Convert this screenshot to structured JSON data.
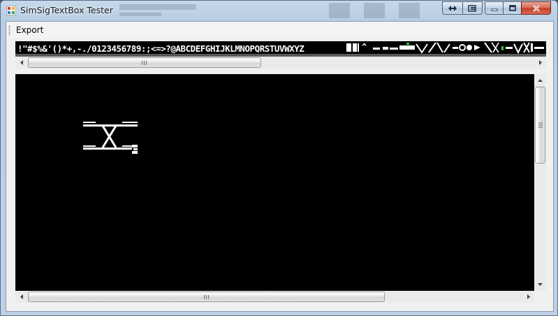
{
  "window": {
    "title": "SimSigTextBox Tester",
    "icon": "app-icon",
    "controls": [
      "back-forward-icon",
      "snap-icon",
      "minimize-icon",
      "maximize-icon",
      "close-icon"
    ]
  },
  "menu": {
    "items": [
      {
        "label": "Export"
      }
    ]
  },
  "charset_strip": {
    "ascii_text": "!\"#$%&'()*+,-./0123456789:;<=>?@ABCDEFGHIJKLMNOPQRSTUVWXYZ",
    "glyph_text": "_ ` ",
    "colors": {
      "background": "#000000",
      "foreground": "#ffffff",
      "accent_green": "#2ecc40"
    }
  },
  "canvas": {
    "background": "#000000",
    "drawing": "crossover-track-icon"
  },
  "scrollbars": {
    "strip_horizontal": {
      "position_fraction": 0.0
    },
    "canvas_horizontal": {
      "position_fraction": 0.0
    },
    "canvas_vertical": {
      "position_fraction": 0.0
    }
  }
}
